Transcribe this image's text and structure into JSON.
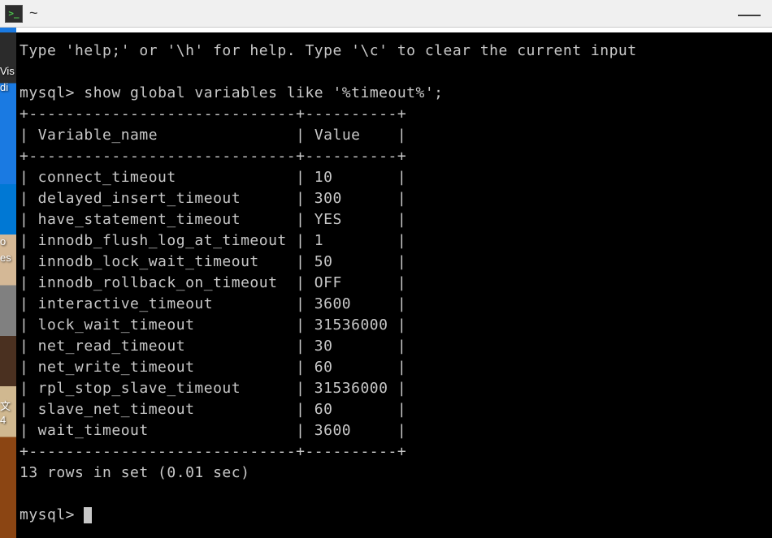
{
  "titlebar": {
    "title": "~",
    "icon_label": ">_"
  },
  "desktop": {
    "fragment1": "Vis",
    "fragment2": "di",
    "fragment3": "o",
    "fragment4": "es",
    "fragment5": "文",
    "fragment6": "4"
  },
  "terminal": {
    "help_line": "Type 'help;' or '\\h' for help. Type '\\c' to clear the current input",
    "prompt": "mysql>",
    "command": "show global variables like '%timeout%';",
    "table": {
      "border_top": "+-----------------------------+----------+",
      "header_col1": "Variable_name",
      "header_col2": "Value",
      "rows": [
        {
          "name": "connect_timeout",
          "value": "10"
        },
        {
          "name": "delayed_insert_timeout",
          "value": "300"
        },
        {
          "name": "have_statement_timeout",
          "value": "YES"
        },
        {
          "name": "innodb_flush_log_at_timeout",
          "value": "1"
        },
        {
          "name": "innodb_lock_wait_timeout",
          "value": "50"
        },
        {
          "name": "innodb_rollback_on_timeout",
          "value": "OFF"
        },
        {
          "name": "interactive_timeout",
          "value": "3600"
        },
        {
          "name": "lock_wait_timeout",
          "value": "31536000"
        },
        {
          "name": "net_read_timeout",
          "value": "30"
        },
        {
          "name": "net_write_timeout",
          "value": "60"
        },
        {
          "name": "rpl_stop_slave_timeout",
          "value": "31536000"
        },
        {
          "name": "slave_net_timeout",
          "value": "60"
        },
        {
          "name": "wait_timeout",
          "value": "3600"
        }
      ]
    },
    "result_line": "13 rows in set (0.01 sec)"
  }
}
